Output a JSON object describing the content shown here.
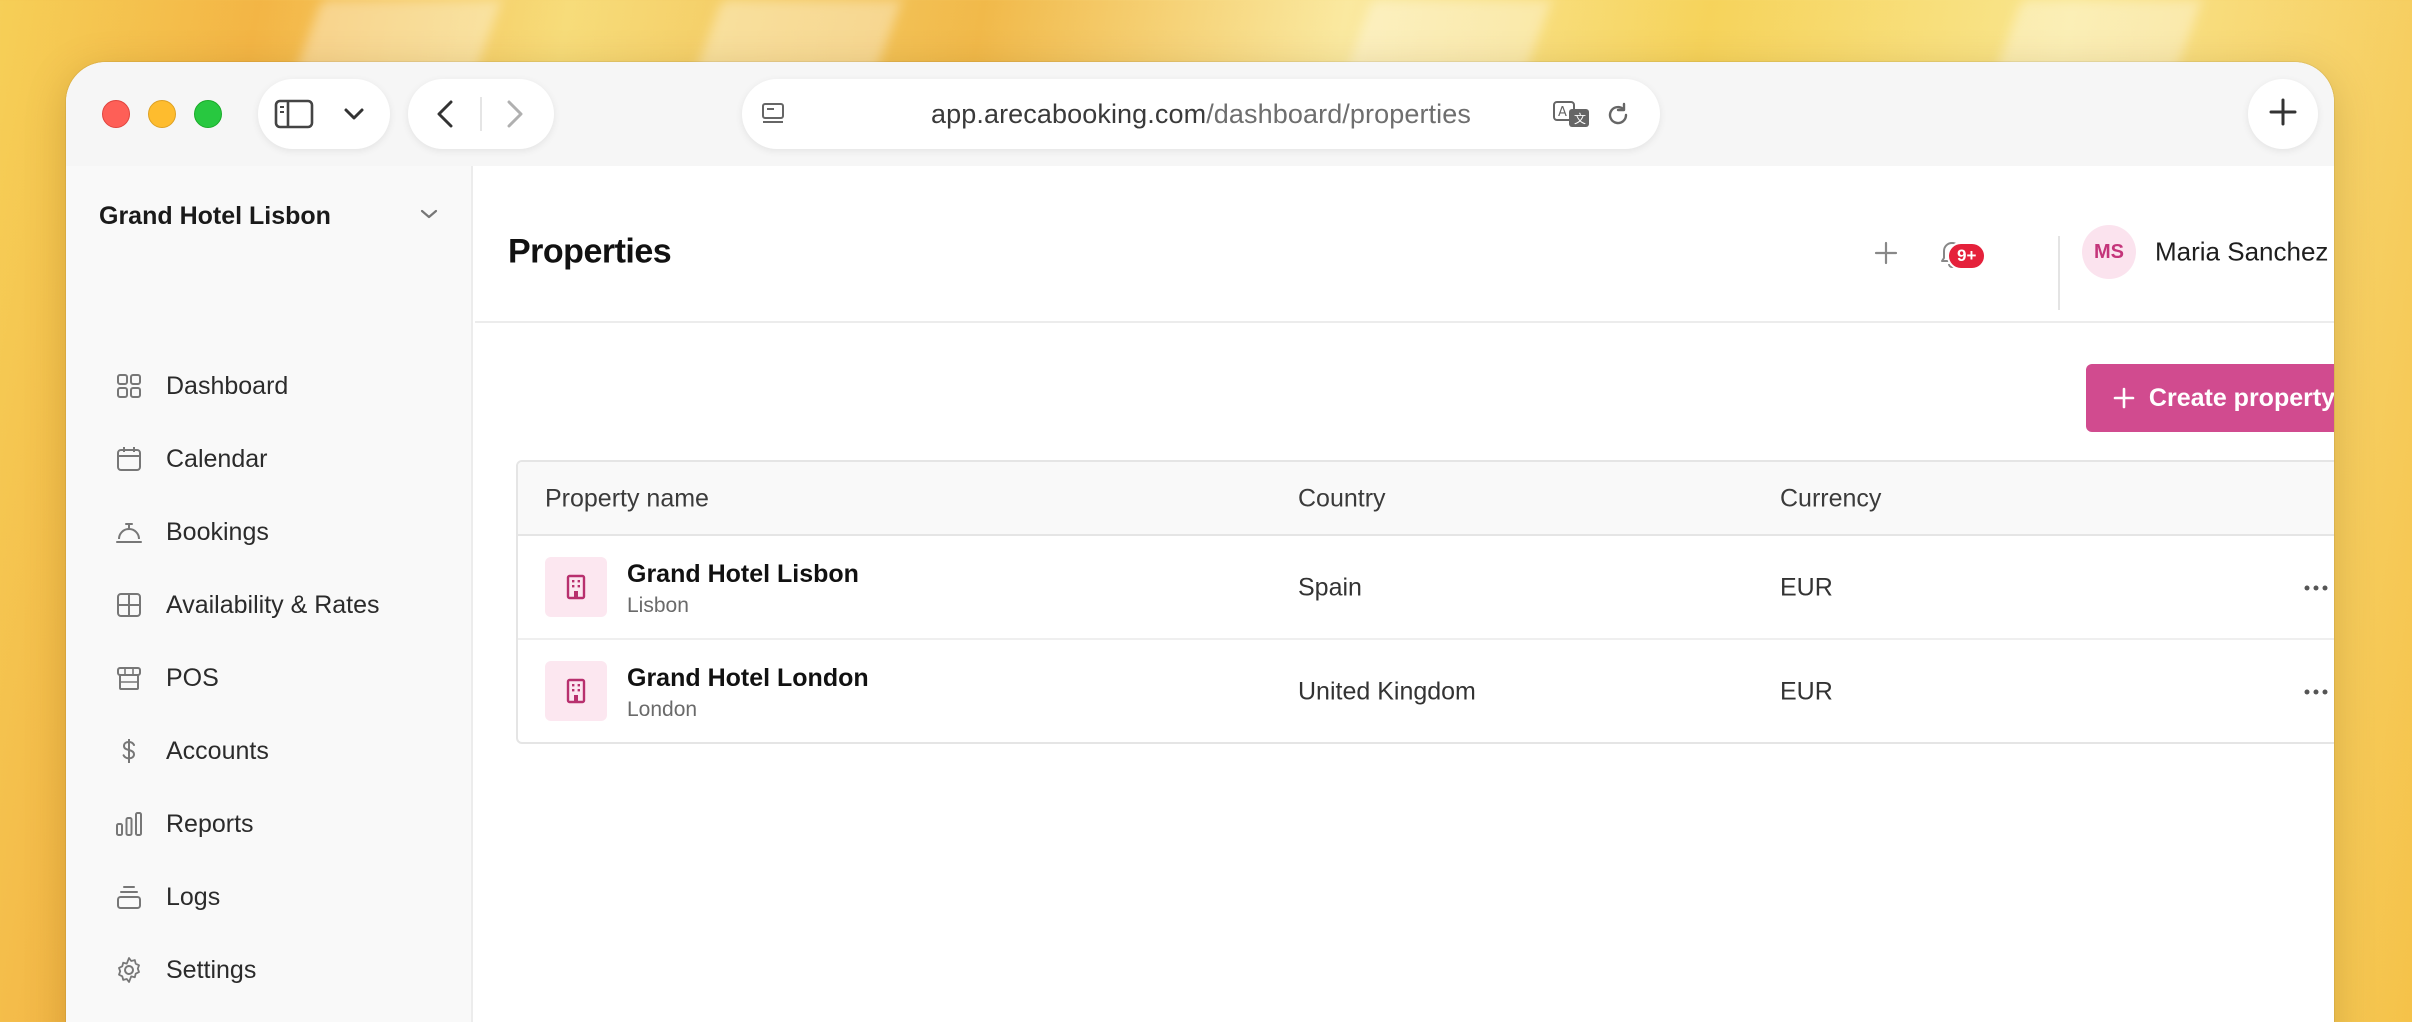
{
  "browser": {
    "url_host": "app.arecabooking.com",
    "url_path": "/dashboard/properties"
  },
  "sidebar": {
    "org_name": "Grand Hotel Lisbon",
    "items": [
      {
        "label": "Dashboard",
        "icon": "grid-icon"
      },
      {
        "label": "Calendar",
        "icon": "calendar-icon"
      },
      {
        "label": "Bookings",
        "icon": "service-bell-icon"
      },
      {
        "label": "Availability & Rates",
        "icon": "table-icon"
      },
      {
        "label": "POS",
        "icon": "store-icon"
      },
      {
        "label": "Accounts",
        "icon": "dollar-icon"
      },
      {
        "label": "Reports",
        "icon": "bar-chart-icon"
      },
      {
        "label": "Logs",
        "icon": "layers-icon"
      },
      {
        "label": "Settings",
        "icon": "gear-icon"
      }
    ]
  },
  "header": {
    "title": "Properties",
    "notification_badge": "9+",
    "user_initials": "MS",
    "user_name": "Maria Sanchez"
  },
  "main": {
    "create_label": "Create property",
    "columns": [
      "Property name",
      "Country",
      "Currency"
    ],
    "rows": [
      {
        "name": "Grand Hotel Lisbon",
        "city": "Lisbon",
        "country": "Spain",
        "currency": "EUR"
      },
      {
        "name": "Grand Hotel London",
        "city": "London",
        "country": "United Kingdom",
        "currency": "EUR"
      }
    ]
  },
  "colors": {
    "accent": "#d14b8f",
    "badge": "#e5213b"
  }
}
